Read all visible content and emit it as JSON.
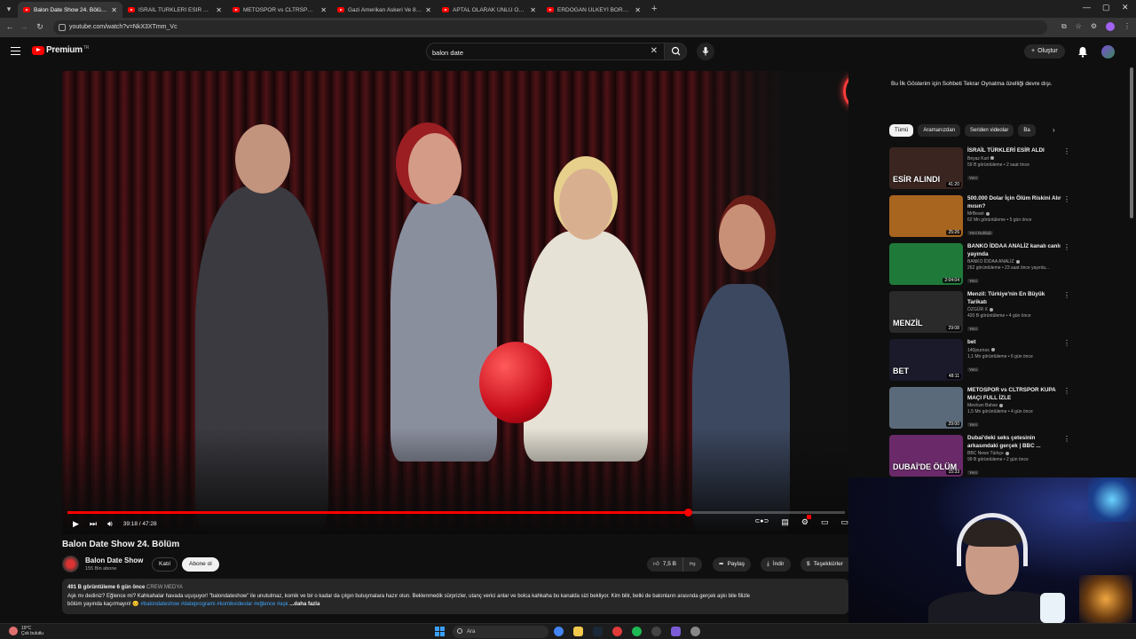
{
  "browser": {
    "tabs": [
      {
        "title": "Balon Date Show 24. Bölüm - YouTube",
        "active": true
      },
      {
        "title": "İSRAİL TÜRKLERİ ESİR ALDI - YouTube",
        "active": false
      },
      {
        "title": "METOSPOR vs CLTRSPOR KUPA MAÇI",
        "active": false
      },
      {
        "title": "Gazi Amerikan Askeri Ve 8 Polis",
        "active": false
      },
      {
        "title": "APTAL OLARAK ÜNLÜ OLMAK",
        "active": false
      },
      {
        "title": "ERDOĞAN ÜLKEYİ BORCA SOKTU",
        "active": false
      }
    ],
    "url": "youtube.com/watch?v=NkX3XTmm_Vc"
  },
  "header": {
    "logo_text": "Premium",
    "country": "TR",
    "search_value": "balon date",
    "create_label": "Oluştur"
  },
  "player": {
    "progress_fraction": 0.798,
    "time_label": "39:18 / 47:28"
  },
  "video": {
    "title": "Balon Date Show 24. Bölüm",
    "channel": "Balon Date Show",
    "subscribers": "155 Bin abone",
    "join_label": "Katıl",
    "subscribe_label": "Abone ol",
    "likes": "7,5 B",
    "share_label": "Paylaş",
    "download_label": "İndir",
    "thanks_label": "Teşekkürler"
  },
  "description": {
    "meta": "491 B görüntüleme  6 gün önce",
    "crew": "CREW MEDYA",
    "line1": "Aşk mı dediniz? Eğlence mi? Kahkahalar havada uçuşuyor! \"balondateshow\" ile unutulmaz, komik ve bir o kadar da çılgın buluşmalara hazır olun. Beklenmedik sürprizler, utanç verici anlar ve bolca kahkaha bu kanalda sizi bekliyor. Kim bilir, belki de balonların arasında gerçek aşkı bile filizle",
    "line2": "bölüm yayında kaçırmayın! 😊 ",
    "hashtags": "#balondateshow #dateprogrami #komikvideolar #eğlence #aşk",
    "more": " ...daha fazla"
  },
  "sidebar": {
    "chat_notice": "Bu İlk Gösterim için Sohbeti Tekrar Oynatma özelliği devre dışı.",
    "chips": [
      "Tümü",
      "Aramanızdan",
      "Seriden videolar",
      "Ba"
    ],
    "recs": [
      {
        "title": "İSRAİL TÜRKLERİ ESİR ALDI",
        "channel": "Beyaz Kurt",
        "meta": "59 B görüntüleme • 2 saat önce",
        "badge": "Yeni",
        "duration": "41:20",
        "thumb_color": "#3a2520",
        "thumb_text": "ESİR ALINDI"
      },
      {
        "title": "500.000 Dolar İçin Ölüm Riskini Alır mısın?",
        "channel": "MrBeast",
        "meta": "62 Mn görüntüleme • 5 gün önce",
        "badge": "Yeni  Dublajlı",
        "duration": "25:26",
        "thumb_color": "#a8651f",
        "thumb_text": ""
      },
      {
        "title": "BANKO İDDAA ANALİZ kanalı canlı yayında",
        "channel": "BANKO İDDAA ANALİZ",
        "meta": "262 görüntüleme • 23 saat önce yayınla...",
        "badge": "Yeni",
        "duration": "2:04:04",
        "thumb_color": "#1f7a3a",
        "thumb_text": ""
      },
      {
        "title": "Menzil: Türkiye'nin En Büyük Tarikatı",
        "channel": "ÖZGÜR X",
        "meta": "420 B görüntüleme • 4 gün önce",
        "badge": "Yeni",
        "duration": "29:08",
        "thumb_color": "#2a2a2a",
        "thumb_text": "MENZİL"
      },
      {
        "title": "bet",
        "channel": "140journos",
        "meta": "1,1 Mn görüntüleme • 6 gün önce",
        "badge": "Yeni",
        "duration": "48:11",
        "thumb_color": "#1a1a2a",
        "thumb_text": "BET"
      },
      {
        "title": "METOSPOR vs CLTRSPOR KUPA MAÇI FULL İZLE",
        "channel": "Mevlcan Bahav",
        "meta": "1,5 Mn görüntüleme • 4 gün önce",
        "badge": "Yeni",
        "duration": "29:00",
        "thumb_color": "#5a6a7a",
        "thumb_text": ""
      },
      {
        "title": "Dubai'deki seks çetesinin arkasındaki gerçek | BBC ...",
        "channel": "BBC News Türkçe",
        "meta": "99 B görüntüleme • 2 gün önce",
        "badge": "Yeni",
        "duration": "15:33",
        "thumb_color": "#6a2a6a",
        "thumb_text": "DUBAİ'DE ÖLÜM"
      }
    ]
  },
  "taskbar": {
    "weather_temp": "19°C",
    "weather_text": "Çok bulutlu",
    "search_placeholder": "Ara"
  }
}
